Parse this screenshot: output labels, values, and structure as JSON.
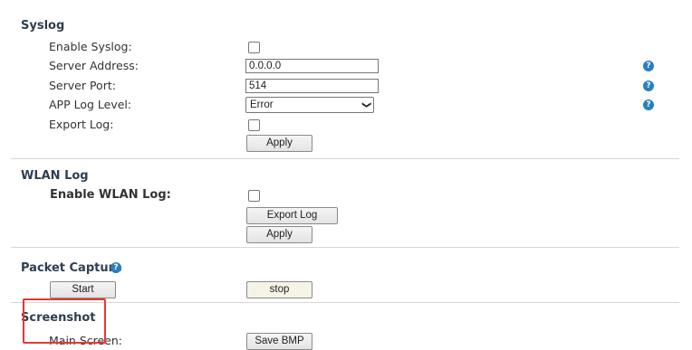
{
  "syslog": {
    "title": "Syslog",
    "enable_label": "Enable Syslog:",
    "server_address_label": "Server Address:",
    "server_address_value": "0.0.0.0",
    "server_port_label": "Server Port:",
    "server_port_value": "514",
    "app_log_level_label": "APP Log Level:",
    "app_log_level_value": "Error",
    "export_log_label": "Export Log:",
    "apply_label": "Apply"
  },
  "wlan_log": {
    "title": "WLAN Log",
    "enable_label": "Enable WLAN Log:",
    "export_log_button": "Export Log",
    "apply_label": "Apply"
  },
  "packet_capture": {
    "title": "Packet Capture",
    "start_label": "Start",
    "stop_label": "stop"
  },
  "screenshot": {
    "title": "Screenshot",
    "main_screen_label": "Main Screen:",
    "save_bmp_label": "Save BMP"
  },
  "help_glyph": "?",
  "select_chevron": "❯",
  "colors": {
    "help_icon": "#2a7fbf",
    "highlight": "#e53935",
    "section_title": "#2f3f50"
  }
}
